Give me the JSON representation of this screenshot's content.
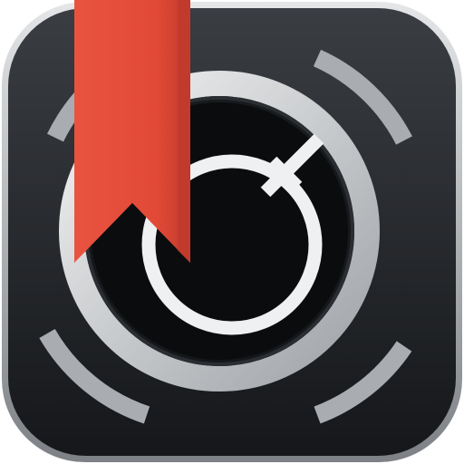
{
  "app_icon": {
    "kind": "app-icon",
    "depicts": [
      "dial-icon",
      "bookmark-ribbon-icon"
    ],
    "colors": {
      "tile_top": "#3a3d42",
      "tile_bottom": "#15171a",
      "tile_rim": "#c9ccd0",
      "face_dark": "#101214",
      "ring_light": "#f2f3f4",
      "ring_shadow": "#9ea2a6",
      "segment_gray": "#a9acb0",
      "ribbon": "#e8533f",
      "ribbon_shadow": "#c23a2b"
    }
  }
}
